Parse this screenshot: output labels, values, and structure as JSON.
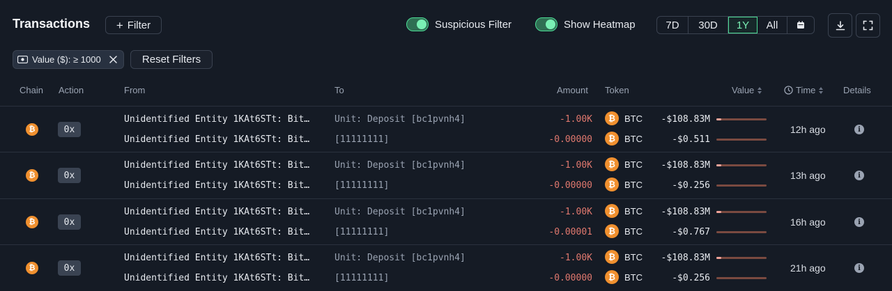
{
  "header": {
    "title": "Transactions",
    "filter_label": "Filter",
    "suspicious_filter_label": "Suspicious Filter",
    "show_heatmap_label": "Show Heatmap",
    "ranges": [
      "7D",
      "30D",
      "1Y",
      "All"
    ],
    "active_range": "1Y",
    "calendar_icon": "calendar-icon",
    "download_icon": "download-icon",
    "fullscreen_icon": "fullscreen-icon"
  },
  "chips": {
    "value_filter": "Value ($): ≥ 1000",
    "reset": "Reset Filters"
  },
  "columns": {
    "chain": "Chain",
    "action": "Action",
    "from": "From",
    "to": "To",
    "amount": "Amount",
    "token": "Token",
    "value": "Value",
    "time": "Time",
    "details": "Details"
  },
  "colors": {
    "accent": "#4cdb95",
    "negative": "#e0786e",
    "btc": "#f0902f"
  },
  "rows": [
    {
      "action": "0x",
      "time": "12h ago",
      "lines": [
        {
          "from": "Unidentified Entity 1KAt6STt: Bit…",
          "to": "Unit: Deposit [bc1pvnh4]",
          "amount": "-1.00K",
          "token": "BTC",
          "value": "-$108.83M",
          "heat": 0.1
        },
        {
          "from": "Unidentified Entity 1KAt6STt: Bit…",
          "to": "[11111111]",
          "amount": "-0.00000",
          "token": "BTC",
          "value": "-$0.511",
          "heat": 0.0
        }
      ]
    },
    {
      "action": "0x",
      "time": "13h ago",
      "lines": [
        {
          "from": "Unidentified Entity 1KAt6STt: Bit…",
          "to": "Unit: Deposit [bc1pvnh4]",
          "amount": "-1.00K",
          "token": "BTC",
          "value": "-$108.83M",
          "heat": 0.1
        },
        {
          "from": "Unidentified Entity 1KAt6STt: Bit…",
          "to": "[11111111]",
          "amount": "-0.00000",
          "token": "BTC",
          "value": "-$0.256",
          "heat": 0.0
        }
      ]
    },
    {
      "action": "0x",
      "time": "16h ago",
      "lines": [
        {
          "from": "Unidentified Entity 1KAt6STt: Bit…",
          "to": "Unit: Deposit [bc1pvnh4]",
          "amount": "-1.00K",
          "token": "BTC",
          "value": "-$108.83M",
          "heat": 0.1
        },
        {
          "from": "Unidentified Entity 1KAt6STt: Bit…",
          "to": "[11111111]",
          "amount": "-0.00001",
          "token": "BTC",
          "value": "-$0.767",
          "heat": 0.0
        }
      ]
    },
    {
      "action": "0x",
      "time": "21h ago",
      "lines": [
        {
          "from": "Unidentified Entity 1KAt6STt: Bit…",
          "to": "Unit: Deposit [bc1pvnh4]",
          "amount": "-1.00K",
          "token": "BTC",
          "value": "-$108.83M",
          "heat": 0.1
        },
        {
          "from": "Unidentified Entity 1KAt6STt: Bit…",
          "to": "[11111111]",
          "amount": "-0.00000",
          "token": "BTC",
          "value": "-$0.256",
          "heat": 0.0
        }
      ]
    }
  ]
}
